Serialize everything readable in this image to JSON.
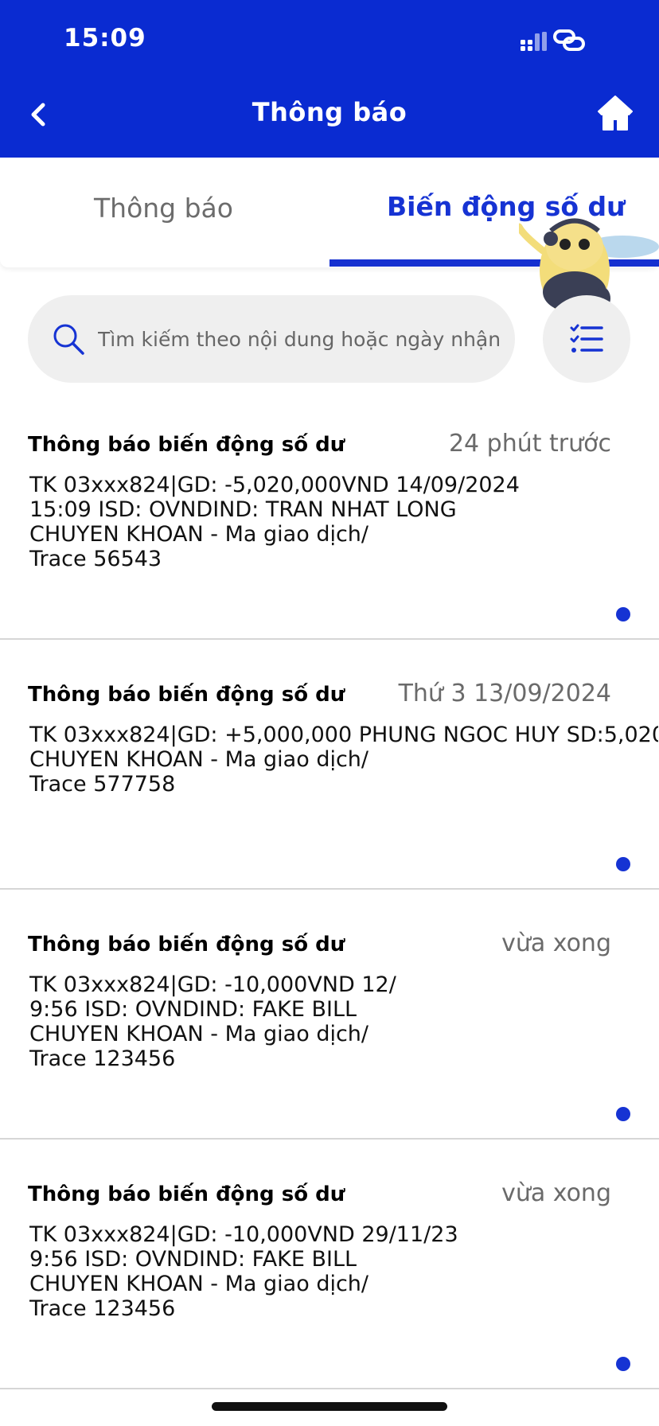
{
  "status_bar": {
    "time": "15:09"
  },
  "header": {
    "title": "Thông báo"
  },
  "tabs": [
    {
      "label": "Thông báo",
      "active": false
    },
    {
      "label": "Biến động số dư",
      "active": true
    }
  ],
  "search": {
    "placeholder": "Tìm kiếm theo nội dung hoặc ngày nhận"
  },
  "notifications": [
    {
      "title": "Thông báo biến động số dư",
      "time": "24 phút trước",
      "lines": [
        "TK 03xxx824|GD: -5,020,000VND 14/09/2024",
        "15:09 ISD: OVNDIND: TRAN NHAT LONG",
        "CHUYEN KHOAN - Ma giao dịch/",
        "Trace 56543"
      ],
      "unread": true
    },
    {
      "title": "Thông báo biến động số dư",
      "time": "Thứ 3 13/09/2024",
      "lines": [
        "TK 03xxx824|GD: +5,000,000 PHUNG NGOC HUY SD:5,020",
        "CHUYEN KHOAN - Ma giao dịch/",
        "Trace 577758"
      ],
      "unread": true
    },
    {
      "title": "Thông báo biến động số dư",
      "time": "vừa xong",
      "lines": [
        "TK 03xxx824|GD: -10,000VND 12/",
        "9:56 ISD: OVNDIND: FAKE BILL",
        "CHUYEN KHOAN - Ma giao dịch/",
        "Trace 123456"
      ],
      "unread": true
    },
    {
      "title": "Thông báo biến động số dư",
      "time": "vừa xong",
      "lines": [
        "TK 03xxx824|GD: -10,000VND 29/11/23",
        "9:56 ISD: OVNDIND: FAKE BILL",
        "CHUYEN KHOAN - Ma giao dịch/",
        "Trace 123456"
      ],
      "unread": true
    }
  ],
  "colors": {
    "brand_blue": "#0a2bd1",
    "accent_blue": "#1633d3",
    "search_bg": "#efefef"
  },
  "icons": [
    "back-arrow-icon",
    "home-icon",
    "signal-icon",
    "link-icon",
    "search-icon",
    "filter-list-icon",
    "mascot-bee-icon"
  ]
}
